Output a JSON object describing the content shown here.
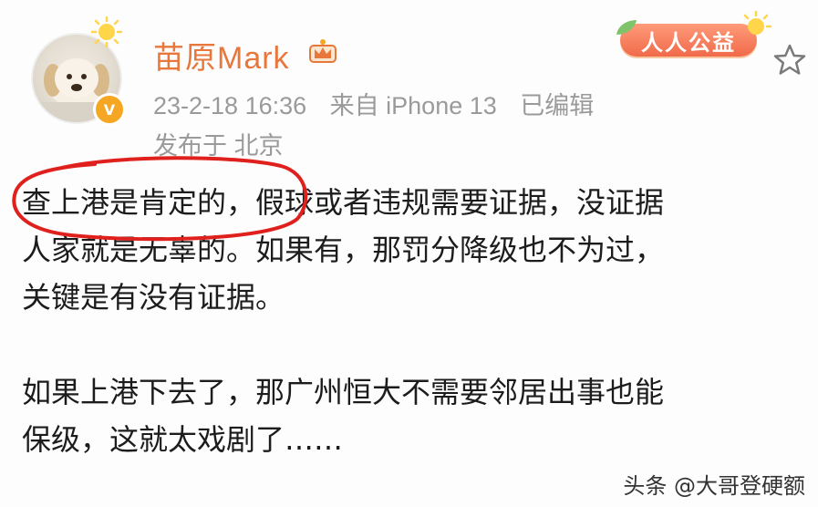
{
  "post": {
    "author": "苗原Mark",
    "timestamp": "23-2-18 16:36",
    "source": "来自 iPhone 13",
    "edited": "已编辑",
    "location": "发布于 北京",
    "badge": "人人公益",
    "paragraph1_line1": "查上港是肯定的，假球或者违规需要证据，没证据",
    "paragraph1_line2": "人家就是无辜的。如果有，那罚分降级也不为过，",
    "paragraph1_line3": "关键是有没有证据。",
    "paragraph2_line1": "如果上港下去了，那广州恒大不需要邻居出事也能",
    "paragraph2_line2": "保级，这就太戏剧了……"
  },
  "icons": {
    "verified": "verified-badge-icon",
    "crown": "crown-icon",
    "star": "star-icon",
    "sun": "sun-icon"
  },
  "colors": {
    "username": "#e8773c",
    "meta": "#9a9a9a",
    "highlight_circle": "#e0201c",
    "verified": "#f5a623"
  },
  "watermark": "头条 @大哥登硬额"
}
